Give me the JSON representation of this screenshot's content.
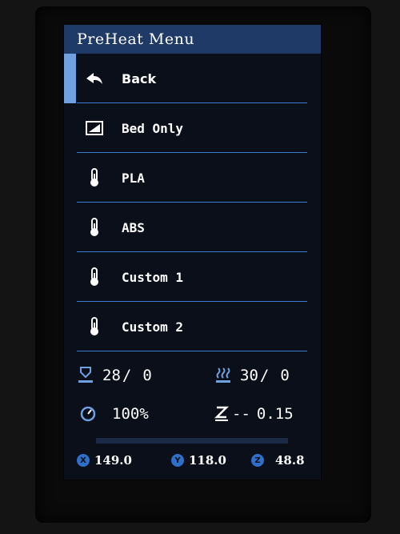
{
  "window": {
    "title": "PreHeat Menu"
  },
  "menu": {
    "items": [
      {
        "label": "Back",
        "icon": "back-arrow-icon"
      },
      {
        "label": "Bed Only",
        "icon": "bed-icon"
      },
      {
        "label": "PLA",
        "icon": "thermometer-icon"
      },
      {
        "label": "ABS",
        "icon": "thermometer-icon"
      },
      {
        "label": "Custom 1",
        "icon": "thermometer-icon"
      },
      {
        "label": "Custom 2",
        "icon": "thermometer-icon"
      }
    ]
  },
  "status": {
    "hotend": {
      "current": "28",
      "separator": "/",
      "target": "0",
      "icon": "hotend-icon"
    },
    "bed": {
      "current": "30",
      "separator": "/",
      "target": "0",
      "icon": "bed-heat-icon"
    },
    "feedrate": {
      "value": "100%",
      "icon": "speed-gauge-icon"
    },
    "zoffset": {
      "prefix": "--",
      "value": "0.15",
      "icon": "z-offset-icon"
    },
    "progress": {
      "fraction": 0.0
    },
    "axes": {
      "x": {
        "badge": "X",
        "value": "149.0"
      },
      "y": {
        "badge": "Y",
        "value": "118.0"
      },
      "z": {
        "badge": "Z",
        "value": "48.8"
      }
    }
  },
  "colors": {
    "accent": "#3b7bd0",
    "title_bar": "#1f3a66",
    "screen_bg": "#0a0f1a",
    "text": "#ffffff"
  }
}
